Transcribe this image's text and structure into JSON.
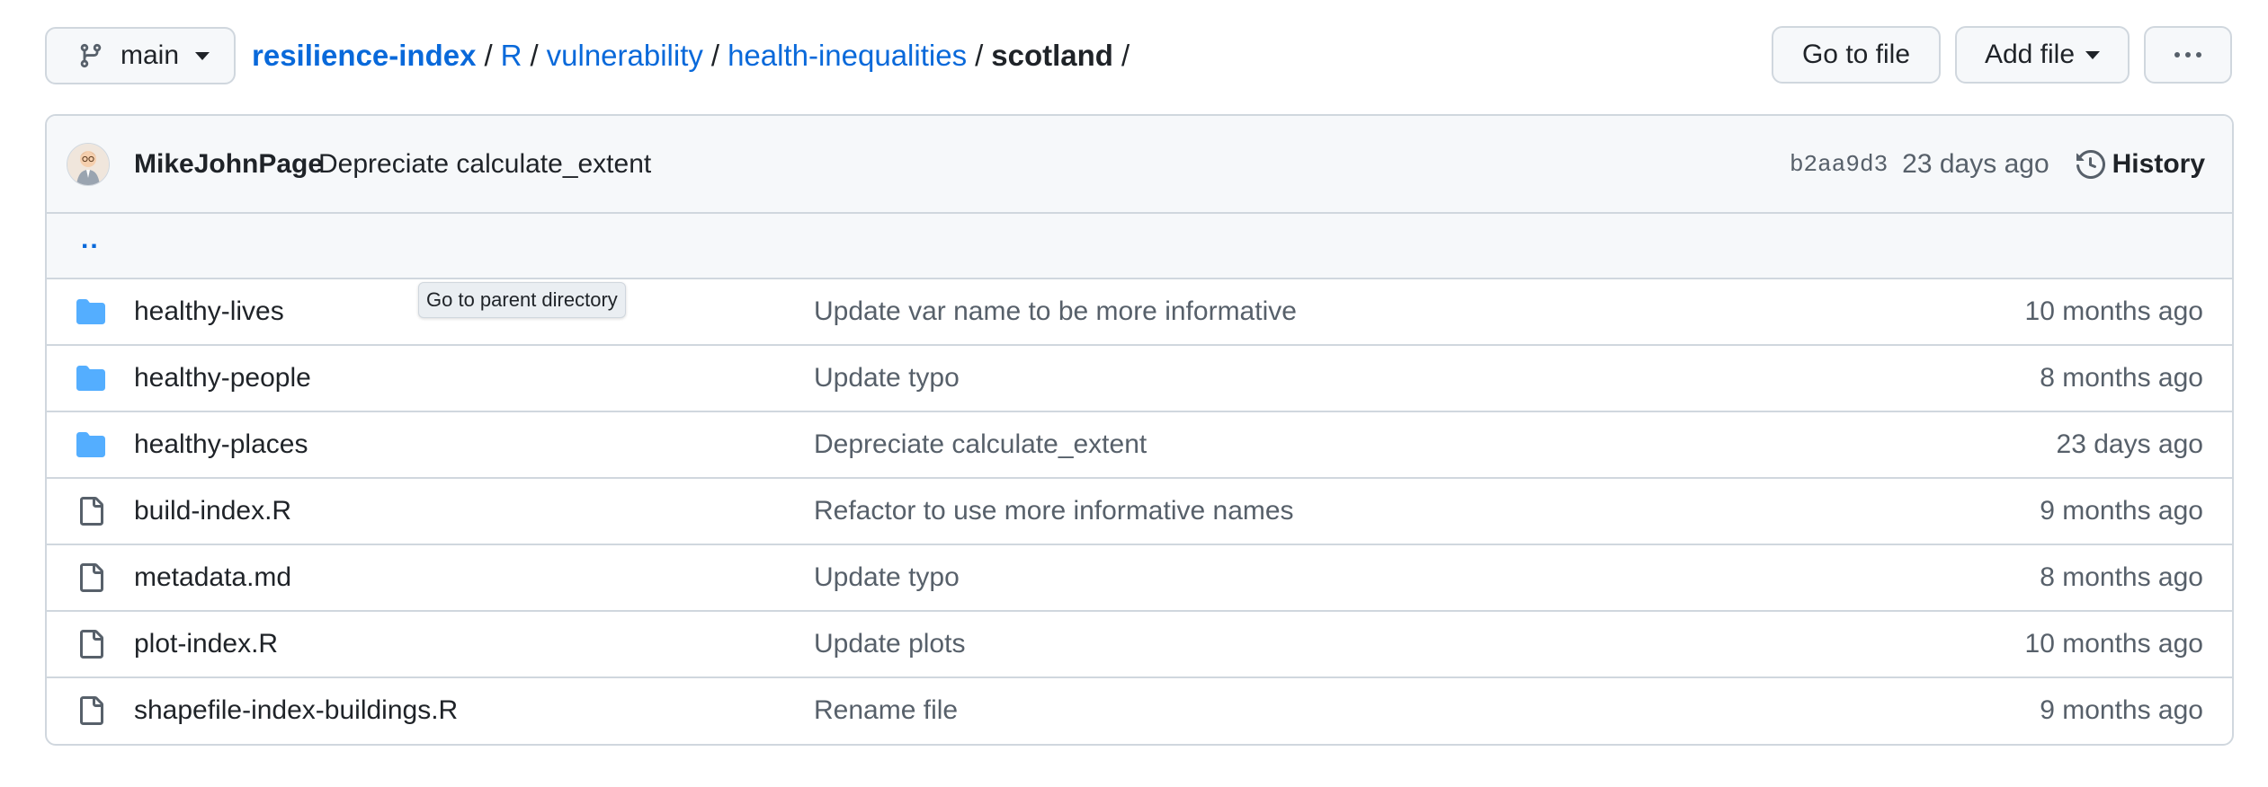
{
  "branch": {
    "name": "main",
    "icon": "git-branch-icon"
  },
  "breadcrumb": {
    "repo": "resilience-index",
    "segments": [
      "R",
      "vulnerability",
      "health-inequalities"
    ],
    "current": "scotland",
    "separator": "/"
  },
  "actions": {
    "go_to_file": "Go to file",
    "add_file": "Add file",
    "more": "more-options-icon"
  },
  "commit": {
    "author": "MikeJohnPage",
    "message": "Depreciate calculate_extent",
    "sha": "b2aa9d3",
    "age": "23 days ago",
    "history_label": "History"
  },
  "parent": {
    "label": "..",
    "tooltip": "Go to parent directory"
  },
  "files": [
    {
      "type": "folder",
      "name": "healthy-lives",
      "message": "Update var name to be more informative",
      "age": "10 months ago"
    },
    {
      "type": "folder",
      "name": "healthy-people",
      "message": "Update typo",
      "age": "8 months ago"
    },
    {
      "type": "folder",
      "name": "healthy-places",
      "message": "Depreciate calculate_extent",
      "age": "23 days ago"
    },
    {
      "type": "file",
      "name": "build-index.R",
      "message": "Refactor to use more informative names",
      "age": "9 months ago"
    },
    {
      "type": "file",
      "name": "metadata.md",
      "message": "Update typo",
      "age": "8 months ago"
    },
    {
      "type": "file",
      "name": "plot-index.R",
      "message": "Update plots",
      "age": "10 months ago"
    },
    {
      "type": "file",
      "name": "shapefile-index-buildings.R",
      "message": "Rename file",
      "age": "9 months ago"
    }
  ],
  "colors": {
    "link": "#0969da",
    "folder": "#54aeff",
    "border": "#d0d7de",
    "muted": "#57606a",
    "header_bg": "#f6f8fa"
  }
}
